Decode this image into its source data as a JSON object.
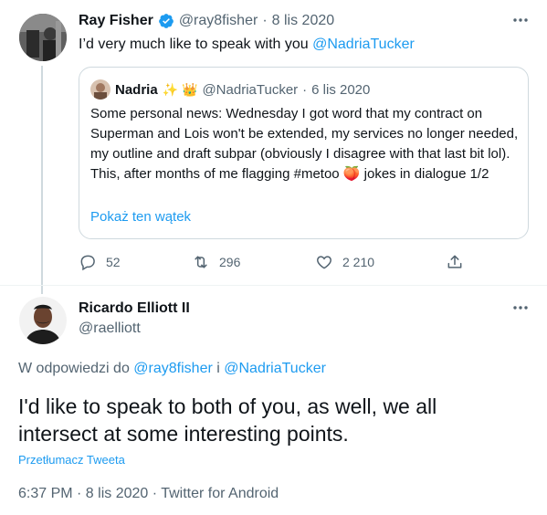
{
  "tweet1": {
    "author_name": "Ray Fisher",
    "handle": "@ray8fisher",
    "dot": "·",
    "date": "8 lis 2020",
    "text_prefix": "I’d very much like to speak with you ",
    "mention": "@NadriaTucker",
    "more_icon": "more-horizontal-icon",
    "verified_icon": "verified-badge-icon",
    "quote": {
      "author_name": "Nadria",
      "emojis": "✨ 👑",
      "handle": "@NadriaTucker",
      "dot": "·",
      "date": "6 lis 2020",
      "text_part1": "Some personal news: Wednesday I got word that my contract on Superman and Lois won't be extended, my services no longer needed, my outline and draft subpar (obviously I disagree with that last bit lol). This, after months of me flagging #metoo ",
      "emoji_inline": "🍑",
      "text_part2": " jokes in dialogue 1/2",
      "show_thread": "Pokaż ten wątek"
    },
    "actions": {
      "replies": "52",
      "retweets": "296",
      "likes": "2 210"
    }
  },
  "tweet2": {
    "author_name": "Ricardo Elliott II",
    "handle": "@raelliott",
    "reply_prefix": "W odpowiedzi do ",
    "reply_to_1": "@ray8fisher",
    "reply_and": " i ",
    "reply_to_2": "@NadriaTucker",
    "text": "I'd like to speak to both of you, as well, we all intersect at some interesting points.",
    "translate": "Przetłumacz Tweeta",
    "meta": "6:37 PM · 8 lis 2020 · Twitter for Android"
  },
  "colors": {
    "accent": "#1d9bf0",
    "muted": "#536471",
    "border": "#cfd9de"
  }
}
